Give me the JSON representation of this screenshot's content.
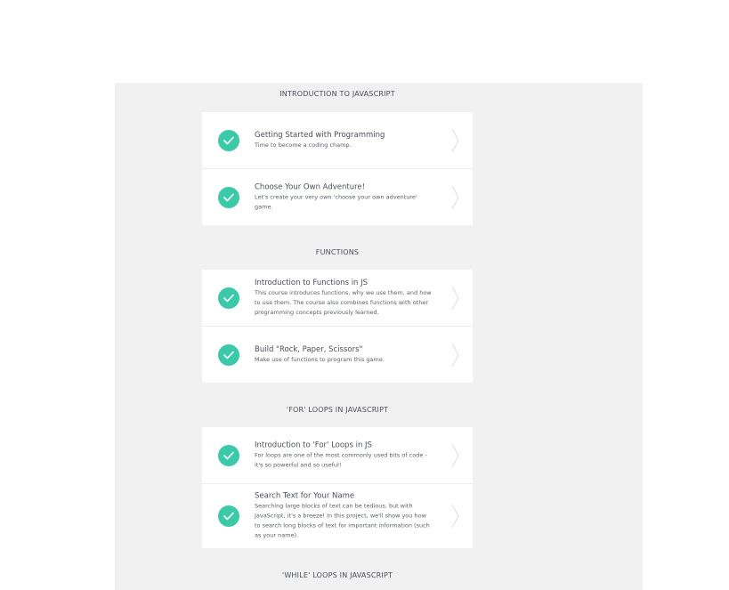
{
  "sections": [
    {
      "title": "INTRODUCTION TO JAVASCRIPT",
      "lessons": [
        {
          "title": "Getting Started with Programming",
          "desc": "Time to become a coding champ."
        },
        {
          "title": "Choose Your Own Adventure!",
          "desc": "Let's create your very own 'choose your own adventure' game."
        }
      ]
    },
    {
      "title": "FUNCTIONS",
      "lessons": [
        {
          "title": "Introduction to Functions in JS",
          "desc": "This course introduces functions, why we use them, and how to use them. The course also combines functions with other programming concepts previously learned."
        },
        {
          "title": "Build \"Rock, Paper, Scissors\"",
          "desc": "Make use of functions to program this game."
        }
      ]
    },
    {
      "title": "'FOR' LOOPS IN JAVASCRIPT",
      "lessons": [
        {
          "title": "Introduction to 'For' Loops in JS",
          "desc": "For loops are one of the most commonly used bits of code - it's so powerful and so useful!"
        },
        {
          "title": "Search Text for Your Name",
          "desc": "Searching large blocks of text can be tedious, but with JavaScript, it's a breeze! In this project, we'll show you how to search long blocks of text for important information (such as your name)."
        }
      ]
    },
    {
      "title": "'WHILE' LOOPS IN JAVASCRIPT"
    }
  ],
  "colors": {
    "accent": "#3cc9a7",
    "panel": "#f1f1f1",
    "text": "#4a4f57"
  },
  "icons": {
    "complete": "check-icon",
    "open": "chevron-right-icon"
  }
}
